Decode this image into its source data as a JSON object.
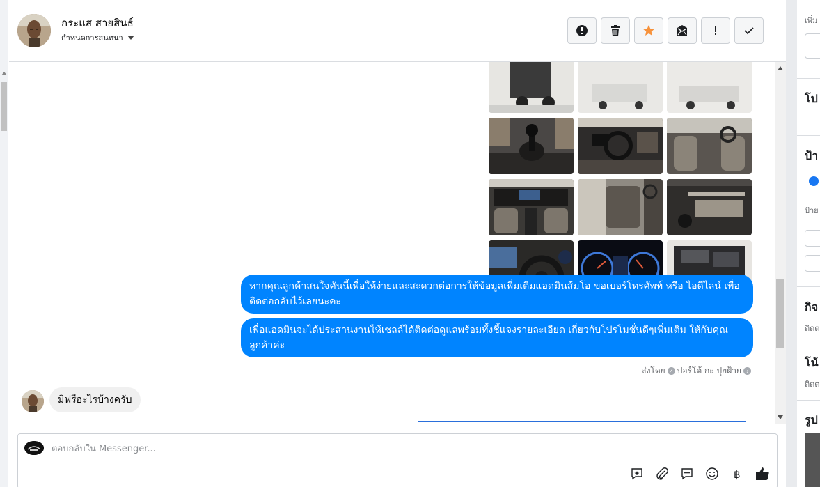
{
  "header": {
    "contact_name": "กระแส สายสินธ์",
    "conversation_settings": "กำหนดการสนทนา"
  },
  "toolbar": {
    "buttons": [
      {
        "icon": "alert-circle-icon"
      },
      {
        "icon": "trash-icon"
      },
      {
        "icon": "star-icon"
      },
      {
        "icon": "mark-unread-icon"
      },
      {
        "icon": "exclamation-icon"
      },
      {
        "icon": "check-icon"
      }
    ],
    "star_color": "#f7923b"
  },
  "messages": {
    "outgoing": [
      "หากคุณลูกค้าสนใจคันนี้เพื่อให้ง่ายและสะดวกต่อการให้ข้อมูลเพิ่มเติมแอดมินส้มโอ ขอเบอร์โทรศัพท์ หรือ ไอดีไลน์ เพื่อติดต่อกลับไว้เลยนะคะ",
      "เพื่อแอดมินจะได้ประสานงานให้เซลล์ได้ติดต่อดูแลพร้อมทั้งชี้แจงรายละเอียด เกี่ยวกับโปรโมชั่นดีๆเพิ่มเติม ให้กับคุณลูกค้าค่ะ"
    ],
    "sent_by_label": "ส่งโดย",
    "sent_by_name": "ปอร์โต้ กะ ปุยฝ้าย",
    "incoming": "มีฟรีอะไรบ้างครับ",
    "outgoing_color": "#0084ff"
  },
  "composer": {
    "placeholder": "ตอบกลับใน Messenger..."
  },
  "right_panel": {
    "headings": [
      "โป",
      "ป้า",
      "กิจ",
      "โน้",
      "รูป"
    ],
    "subtexts": [
      "เพิ่ม",
      "ป้าย",
      "ติดต",
      "ติดต"
    ]
  }
}
